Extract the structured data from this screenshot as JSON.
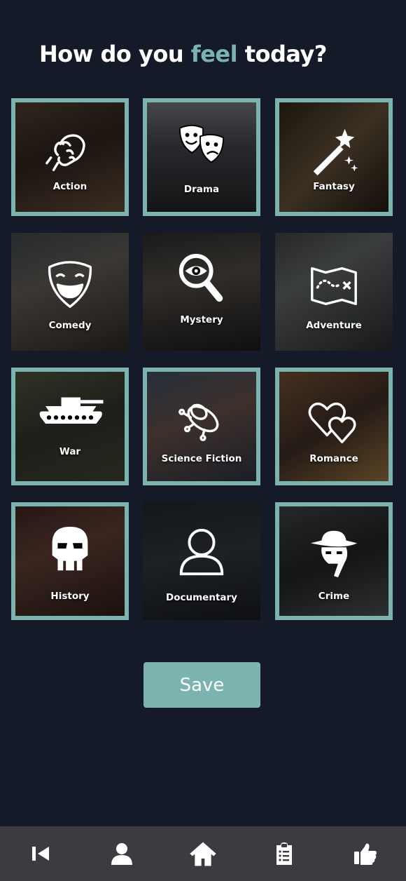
{
  "header": {
    "title_before": "How do you ",
    "title_accent": "feel",
    "title_after": " today?"
  },
  "genres": [
    {
      "label": "Action",
      "selected": true,
      "icon": "fist-icon"
    },
    {
      "label": "Drama",
      "selected": true,
      "icon": "theater-masks-icon"
    },
    {
      "label": "Fantasy",
      "selected": true,
      "icon": "magic-wand-icon"
    },
    {
      "label": "Comedy",
      "selected": false,
      "icon": "laughing-mask-icon"
    },
    {
      "label": "Mystery",
      "selected": false,
      "icon": "magnifier-eye-icon"
    },
    {
      "label": "Adventure",
      "selected": false,
      "icon": "treasure-map-icon"
    },
    {
      "label": "War",
      "selected": true,
      "icon": "tank-icon"
    },
    {
      "label": "Science Fiction",
      "selected": true,
      "icon": "ufo-icon"
    },
    {
      "label": "Romance",
      "selected": true,
      "icon": "hearts-icon"
    },
    {
      "label": "History",
      "selected": true,
      "icon": "gladiator-helmet-icon"
    },
    {
      "label": "Documentary",
      "selected": false,
      "icon": "person-icon"
    },
    {
      "label": "Crime",
      "selected": true,
      "icon": "detective-icon"
    }
  ],
  "save_label": "Save",
  "nav": [
    {
      "name": "back-icon"
    },
    {
      "name": "profile-icon"
    },
    {
      "name": "home-icon"
    },
    {
      "name": "clipboard-list-icon"
    },
    {
      "name": "thumbs-up-icon"
    }
  ],
  "colors": {
    "background": "#141a28",
    "accent": "#7bb3ae",
    "nav_bar": "#3a3c42"
  }
}
